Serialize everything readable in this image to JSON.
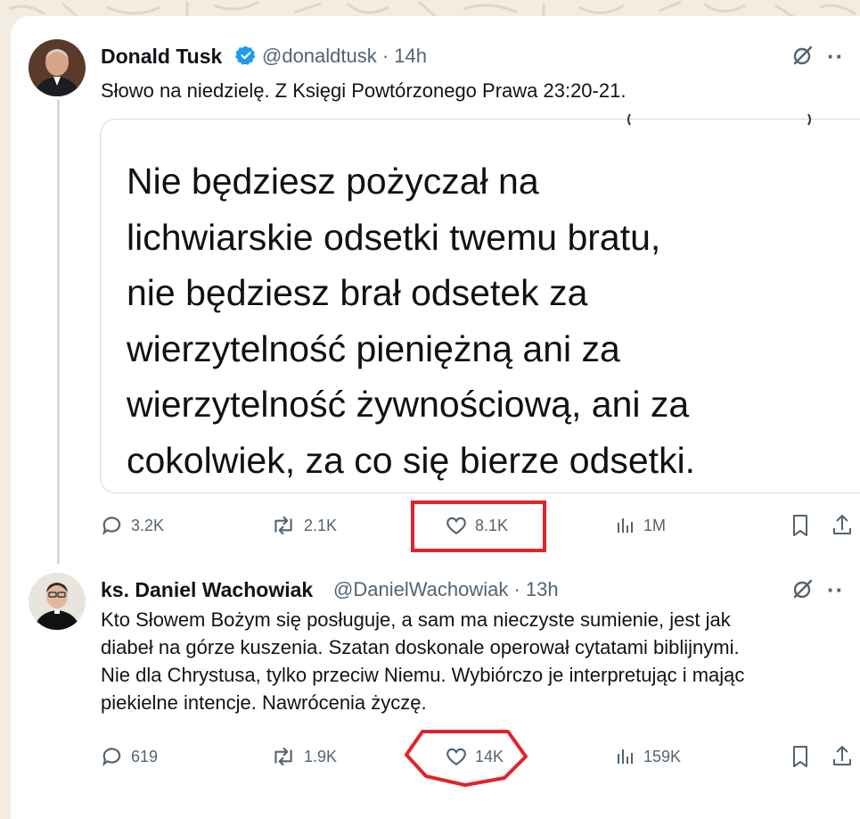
{
  "tweets": [
    {
      "author": "Donald Tusk",
      "handle": "@donaldtusk · 14h",
      "text": "Słowo na niedzielę. Z Księgi Powtórzonego Prawa 23:20-21.",
      "quote_lines": [
        "Nie będziesz pożyczał na",
        "lichwiarskie odsetki twemu bratu,",
        "nie będziesz brał odsetek za",
        "wierzytelność pieniężną ani za",
        "wierzytelność żywnościową, ani za",
        "cokolwiek, za co się bierze odsetki."
      ],
      "replies": "3.2K",
      "reposts": "2.1K",
      "likes": "8.1K",
      "views": "1M",
      "more": "··"
    },
    {
      "author": "ks. Daniel Wachowiak",
      "handle": "@DanielWachowiak · 13h",
      "text_lines": [
        "Kto Słowem Bożym się posługuje, a sam ma nieczyste sumienie, jest jak",
        "diabeł na górze kuszenia. Szatan doskonale operował cytatami biblijnymi.",
        "Nie dla Chrystusa, tylko przeciw Niemu. Wybiórczo je interpretując i mając",
        "piekielne intencje. Nawrócenia życzę."
      ],
      "replies": "619",
      "reposts": "1.9K",
      "likes": "14K",
      "views": "159K",
      "more": "··"
    }
  ],
  "colors": {
    "verified": "#1d9bf0",
    "muted": "#536471",
    "highlight": "#e0242b"
  }
}
